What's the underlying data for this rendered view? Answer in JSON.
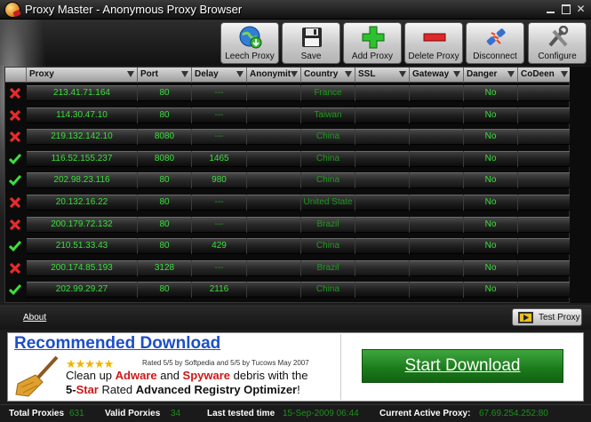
{
  "window": {
    "title": "Proxy Master - Anonymous Proxy Browser"
  },
  "toolbar": {
    "buttons": [
      {
        "label": "Leech Proxy",
        "icon": "globe-download-icon"
      },
      {
        "label": "Save",
        "icon": "floppy-disk-icon"
      },
      {
        "label": "Add Proxy",
        "icon": "green-plus-icon"
      },
      {
        "label": "Delete Proxy",
        "icon": "red-minus-icon"
      },
      {
        "label": "Disconnect",
        "icon": "unplug-icon"
      },
      {
        "label": "Configure",
        "icon": "tools-icon"
      }
    ]
  },
  "grid": {
    "columns": [
      "Proxy",
      "Port",
      "Delay",
      "Anonymit",
      "Country",
      "SSL",
      "Gateway",
      "Danger",
      "CoDeen"
    ],
    "rows": [
      {
        "status": "fail",
        "ip": "213.41.71.164",
        "port": "80",
        "delay": "---",
        "country": "France",
        "danger": "No"
      },
      {
        "status": "fail",
        "ip": "114.30.47.10",
        "port": "80",
        "delay": "---",
        "country": "Taiwan",
        "danger": "No"
      },
      {
        "status": "fail",
        "ip": "219.132.142.10",
        "port": "8080",
        "delay": "---",
        "country": "China",
        "danger": "No"
      },
      {
        "status": "ok",
        "ip": "116.52.155.237",
        "port": "8080",
        "delay": "1465",
        "country": "China",
        "danger": "No"
      },
      {
        "status": "ok",
        "ip": "202.98.23.116",
        "port": "80",
        "delay": "980",
        "country": "China",
        "danger": "No"
      },
      {
        "status": "fail",
        "ip": "20.132.16.22",
        "port": "80",
        "delay": "---",
        "country": "United State",
        "danger": "No"
      },
      {
        "status": "fail",
        "ip": "200.179.72.132",
        "port": "80",
        "delay": "---",
        "country": "Brazil",
        "danger": "No"
      },
      {
        "status": "ok",
        "ip": "210.51.33.43",
        "port": "80",
        "delay": "429",
        "country": "China",
        "danger": "No"
      },
      {
        "status": "fail",
        "ip": "200.174.85.193",
        "port": "3128",
        "delay": "---",
        "country": "Brazil",
        "danger": "No"
      },
      {
        "status": "ok",
        "ip": "202.99.29.27",
        "port": "80",
        "delay": "2116",
        "country": "China",
        "danger": "No"
      }
    ]
  },
  "footer": {
    "about": "About",
    "test_proxy": "Test Proxy"
  },
  "ad": {
    "title": "Recommended Download",
    "rated": "Rated 5/5 by Softpedia and 5/5 by Tucows May 2007",
    "line1_a": "Clean up ",
    "line1_b": "Adware",
    "line1_c": " and ",
    "line1_d": "Spyware",
    "line1_e": " debris with the",
    "line2_a": "5-",
    "line2_b": "Star",
    "line2_c": " Rated ",
    "line2_d": "Advanced Registry Optimizer",
    "line2_e": "!",
    "start": "Start Download"
  },
  "status": {
    "total_label": "Total Proxies",
    "total_value": "631",
    "valid_label": "Valid Porxies",
    "valid_value": "34",
    "last_label": "Last tested time",
    "last_value": "15-Sep-2009 06:44",
    "active_label": "Current Active Proxy:",
    "active_value": "67.69.254.252:80"
  },
  "colors": {
    "accent_green": "#39e039",
    "ad_blue": "#1e4fc6",
    "ad_red": "#d01818"
  }
}
